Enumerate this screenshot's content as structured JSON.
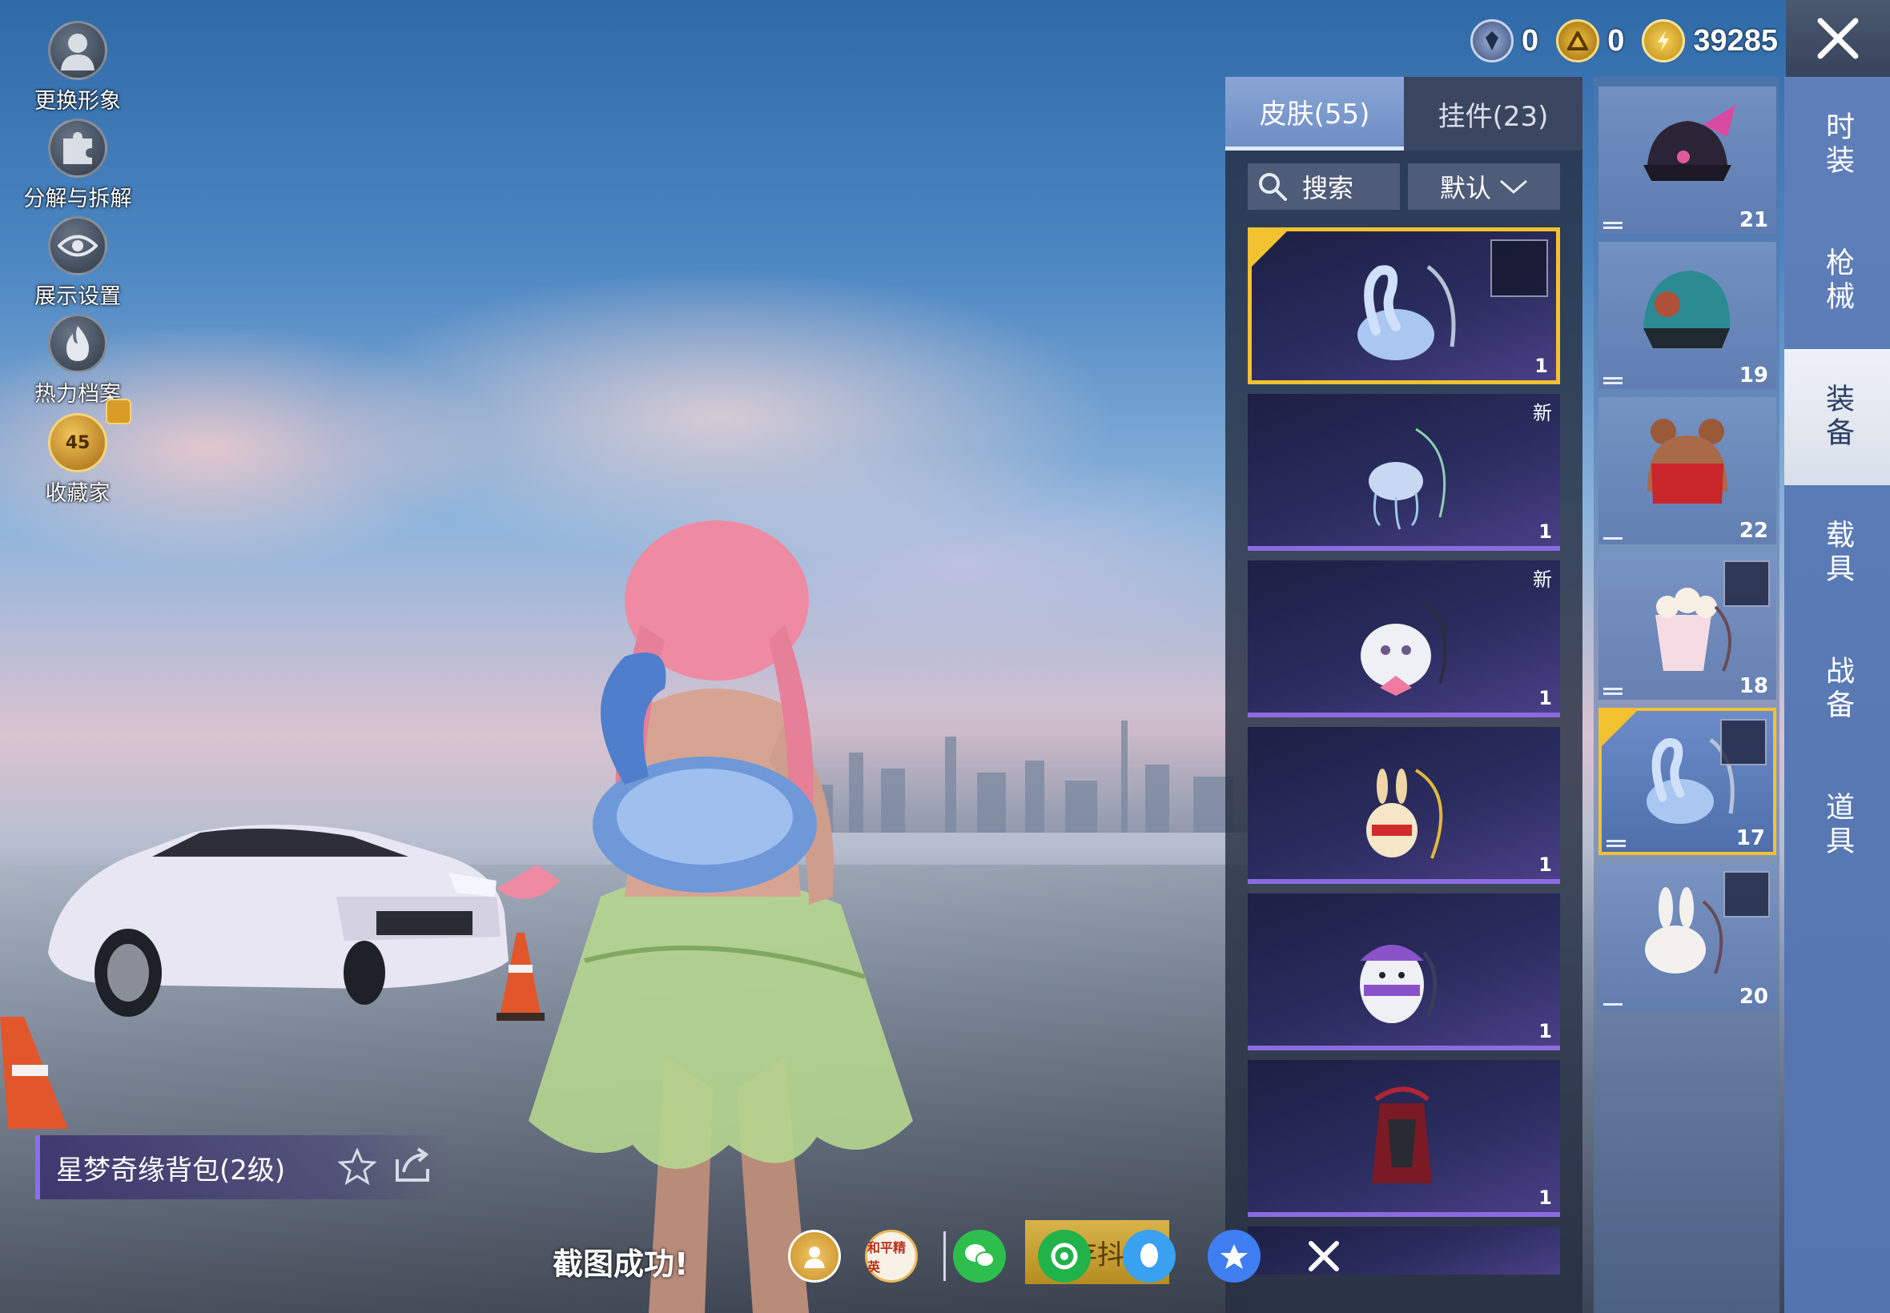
{
  "side_menu": [
    {
      "id": "change-look",
      "label": "更换形象"
    },
    {
      "id": "decompose",
      "label": "分解与拆解"
    },
    {
      "id": "display-settings",
      "label": "展示设置"
    },
    {
      "id": "heat-archive",
      "label": "热力档案"
    },
    {
      "id": "collector",
      "label": "收藏家",
      "level": "45"
    }
  ],
  "currency": [
    {
      "icon": "medal-coin-icon",
      "value": "0"
    },
    {
      "icon": "gold-token-icon",
      "value": "0"
    },
    {
      "icon": "lightning-coin-icon",
      "value": "39285"
    }
  ],
  "tabs": [
    {
      "label": "皮肤(55)",
      "active": true
    },
    {
      "label": "挂件(23)",
      "active": false
    }
  ],
  "search": {
    "label": "搜索"
  },
  "sort": {
    "label": "默认"
  },
  "items": [
    {
      "name": "swan-backpack",
      "qty": "1",
      "new": "",
      "selected": true,
      "has_pendant": true
    },
    {
      "name": "jellyfish-backpack",
      "qty": "1",
      "new": "新",
      "selected": false,
      "has_pendant": false
    },
    {
      "name": "cute-pink-backpack",
      "qty": "1",
      "new": "新",
      "selected": false,
      "has_pendant": false
    },
    {
      "name": "bunny-plush-backpack",
      "qty": "1",
      "new": "",
      "selected": false,
      "has_pendant": false
    },
    {
      "name": "penguin-backpack",
      "qty": "1",
      "new": "",
      "selected": false,
      "has_pendant": false
    },
    {
      "name": "red-mech-backpack",
      "qty": "1",
      "new": "",
      "selected": false,
      "has_pendant": false
    }
  ],
  "slots": [
    {
      "name": "cat-ear-helmet",
      "count": "21",
      "selected": false
    },
    {
      "name": "teal-helmet",
      "count": "19",
      "selected": false
    },
    {
      "name": "bear-red-helmet",
      "count": "22",
      "selected": false
    },
    {
      "name": "popcorn-backpack",
      "count": "18",
      "selected": false
    },
    {
      "name": "swan-backpack",
      "count": "17",
      "selected": true
    },
    {
      "name": "bunny-backpack",
      "count": "20",
      "selected": false
    }
  ],
  "categories": [
    {
      "label": "时装",
      "active": false
    },
    {
      "label": "枪械",
      "active": false
    },
    {
      "label": "装备",
      "active": true
    },
    {
      "label": "载具",
      "active": false
    },
    {
      "label": "战备",
      "active": false
    },
    {
      "label": "道具",
      "active": false
    }
  ],
  "item_title": "星梦奇缘背包(2级)",
  "screenshot": {
    "message": "截图成功!",
    "save_label": "存抖",
    "peace_elite_label": "和平精英"
  },
  "colors": {
    "selected_border": "#f2c230",
    "rarity_purple": "#8c6ae0"
  }
}
